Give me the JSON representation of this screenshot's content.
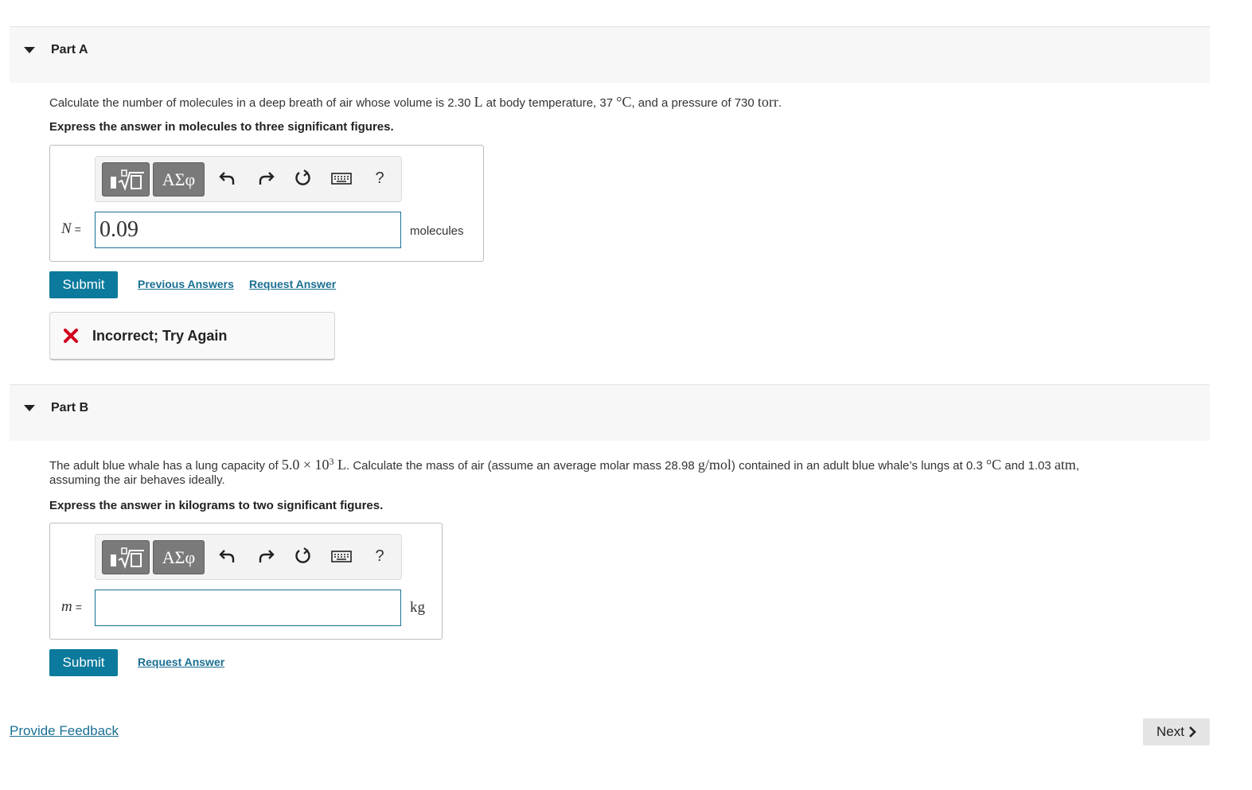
{
  "partA": {
    "title": "Part A",
    "question": {
      "t1": "Calculate the number of molecules in a deep breath of air whose volume is 2.30 ",
      "u1": "L",
      "t2": " at body temperature, 37 ",
      "u2": "°C",
      "t3": ", and a pressure of 730 ",
      "u3": "torr",
      "t4": "."
    },
    "instruction": "Express the answer in molecules to three significant figures.",
    "variable": "N",
    "equals": "=",
    "input_value": "0.09",
    "unit": "molecules",
    "submit_label": "Submit",
    "previous_answers_label": "Previous Answers",
    "request_answer_label": "Request Answer",
    "feedback": "Incorrect; Try Again"
  },
  "toolbar": {
    "greek_label": "ΑΣφ",
    "help_label": "?",
    "icons": [
      "templates-icon",
      "greek-symbols-icon",
      "undo-icon",
      "redo-icon",
      "reset-icon",
      "keyboard-icon",
      "help-icon"
    ]
  },
  "partB": {
    "title": "Part B",
    "question": {
      "t1": "The adult blue whale has a lung capacity of ",
      "m1": "5.0 × 10",
      "m1sup": "3",
      "m1u": " L",
      "t2": ". Calculate the mass of air (assume an average molar mass 28.98 ",
      "m2": "g/mol",
      "t3": ") contained in an adult blue whale’s lungs at 0.3 ",
      "m3": "°C",
      "t4": " and 1.03 ",
      "m4": "atm",
      "t5": ",",
      "line2": "assuming the air behaves ideally."
    },
    "instruction": "Express the answer in kilograms to two significant figures.",
    "variable": "m",
    "equals": "=",
    "input_value": "",
    "unit": "kg",
    "submit_label": "Submit",
    "request_answer_label": "Request Answer"
  },
  "footer": {
    "feedback_link": "Provide Feedback",
    "next_label": "Next"
  },
  "colors": {
    "accent": "#0b7a9c",
    "link": "#1a6f93",
    "error": "#d0021b",
    "header_bg": "#f7f7f7"
  }
}
